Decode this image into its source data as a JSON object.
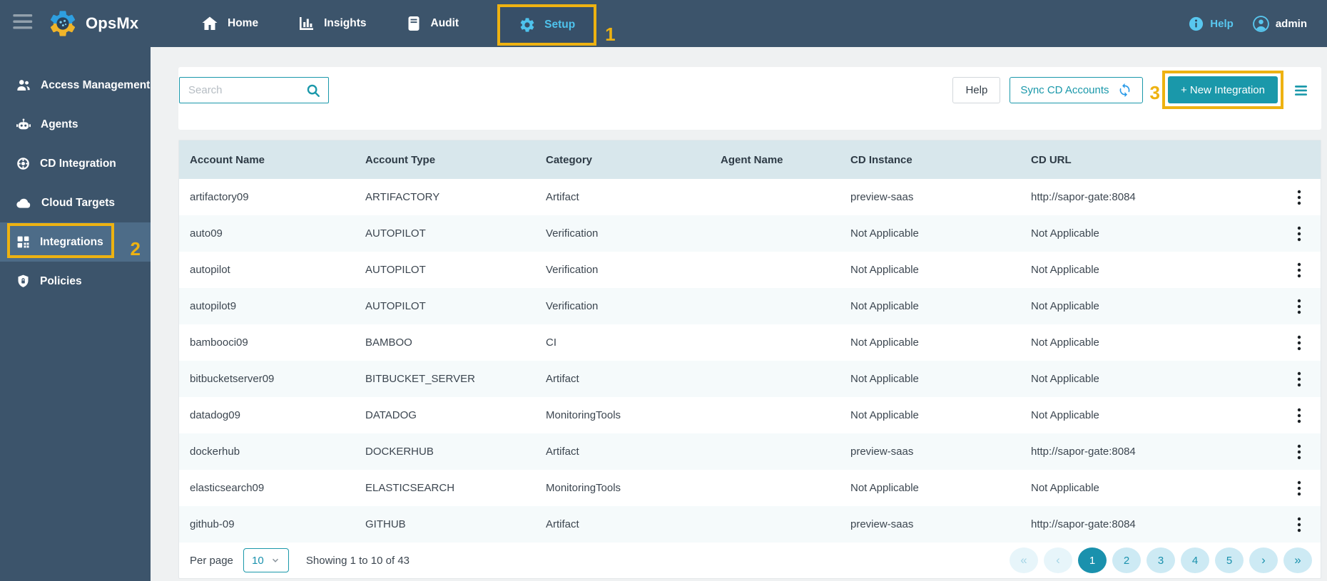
{
  "brand": {
    "name": "OpsMx",
    "logo_icon": "gear-brain-logo"
  },
  "navbar": {
    "items": [
      {
        "label": "Home",
        "icon": "home-icon",
        "active": false
      },
      {
        "label": "Insights",
        "icon": "bar-chart-icon",
        "active": false
      },
      {
        "label": "Audit",
        "icon": "journal-icon",
        "active": false
      },
      {
        "label": "Setup",
        "icon": "gear-icon",
        "active": true
      }
    ],
    "help_label": "Help",
    "user_label": "admin"
  },
  "annotations": {
    "step1": "1",
    "step2": "2",
    "step3": "3",
    "highlight_color": "#eeb211"
  },
  "sidebar": {
    "items": [
      {
        "label": "Access Management",
        "icon": "people-icon",
        "active": false
      },
      {
        "label": "Agents",
        "icon": "robot-icon",
        "active": false
      },
      {
        "label": "CD Integration",
        "icon": "lifebuoy-icon",
        "active": false
      },
      {
        "label": "Cloud Targets",
        "icon": "cloud-icon",
        "active": false
      },
      {
        "label": "Integrations",
        "icon": "grid-icon",
        "active": true
      },
      {
        "label": "Policies",
        "icon": "shield-lock-icon",
        "active": false
      }
    ]
  },
  "toolbar": {
    "search_placeholder": "Search",
    "help_label": "Help",
    "sync_label": "Sync CD Accounts",
    "new_integration_label": "+ New Integration"
  },
  "table": {
    "columns": [
      "Account Name",
      "Account Type",
      "Category",
      "Agent Name",
      "CD Instance",
      "CD URL"
    ],
    "rows": [
      [
        "artifactory09",
        "ARTIFACTORY",
        "Artifact",
        "",
        "preview-saas",
        "http://sapor-gate:8084"
      ],
      [
        "auto09",
        "AUTOPILOT",
        "Verification",
        "",
        "Not Applicable",
        "Not Applicable"
      ],
      [
        "autopilot",
        "AUTOPILOT",
        "Verification",
        "",
        "Not Applicable",
        "Not Applicable"
      ],
      [
        "autopilot9",
        "AUTOPILOT",
        "Verification",
        "",
        "Not Applicable",
        "Not Applicable"
      ],
      [
        "bambooci09",
        "BAMBOO",
        "CI",
        "",
        "Not Applicable",
        "Not Applicable"
      ],
      [
        "bitbucketserver09",
        "BITBUCKET_SERVER",
        "Artifact",
        "",
        "Not Applicable",
        "Not Applicable"
      ],
      [
        "datadog09",
        "DATADOG",
        "MonitoringTools",
        "",
        "Not Applicable",
        "Not Applicable"
      ],
      [
        "dockerhub",
        "DOCKERHUB",
        "Artifact",
        "",
        "preview-saas",
        "http://sapor-gate:8084"
      ],
      [
        "elasticsearch09",
        "ELASTICSEARCH",
        "MonitoringTools",
        "",
        "Not Applicable",
        "Not Applicable"
      ],
      [
        "github-09",
        "GITHUB",
        "Artifact",
        "",
        "preview-saas",
        "http://sapor-gate:8084"
      ]
    ]
  },
  "pagination": {
    "per_page_label": "Per page",
    "per_page_value": "10",
    "summary": "Showing 1 to 10 of 43",
    "first_label": "«",
    "prev_label": "‹",
    "pages": [
      "1",
      "2",
      "3",
      "4",
      "5"
    ],
    "active_page": "1",
    "next_label": "›",
    "last_label": "»"
  },
  "colors": {
    "navbar_bg": "#3c546b",
    "sidebar_selected_bg": "#4d6c88",
    "accent_teal": "#1a98aa",
    "active_cyan": "#4ec3ed",
    "highlight_yellow": "#eeb211",
    "table_header_bg": "#d8e7ec",
    "row_alt_bg": "#f5fafb",
    "pagination_pill_bg": "#cdeaf4",
    "pagination_active_bg": "#1a91ad",
    "refresh_blue": "#2b9be8"
  }
}
